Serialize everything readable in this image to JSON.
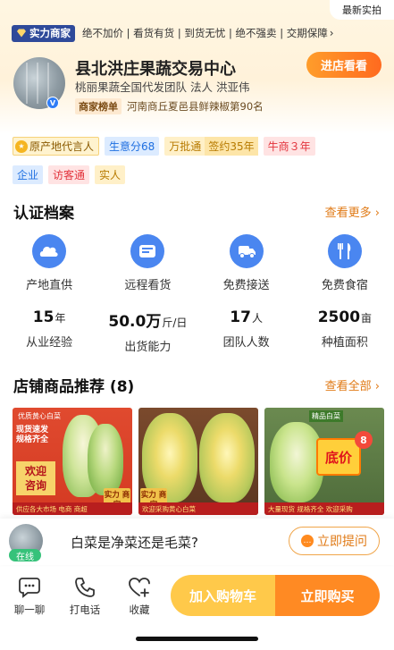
{
  "header": {
    "latest_photo": "最新实拍",
    "power_badge": "实力商家",
    "guarantees": "绝不加价 | 看货有货 | 到货无忧 | 绝不强卖 | 交期保障",
    "shop_name": "县北洪庄果蔬交易中心",
    "subtitle": "桃丽果蔬全国代发团队  法人  洪亚伟",
    "rank_tag": "商家榜单",
    "rank_text": "河南商丘夏邑县鲜辣椒第90名",
    "enter_button": "进店看看"
  },
  "tags": {
    "origin": "原产地代言人",
    "score": "生意分68",
    "wanpitong": "万批通",
    "sign": "签约35年",
    "niushang": "牛商３年",
    "qiye": "企业",
    "fangketong": "访客通",
    "shiren": "实人"
  },
  "certification": {
    "title": "认证档案",
    "more": "查看更多",
    "features": [
      {
        "label": "产地直供",
        "icon": "cloud-icon"
      },
      {
        "label": "远程看货",
        "icon": "camera-icon"
      },
      {
        "label": "免费接送",
        "icon": "car-icon"
      },
      {
        "label": "免费食宿",
        "icon": "utensils-icon"
      }
    ],
    "stats": [
      {
        "value": "15",
        "unit": "年",
        "label": "从业经验"
      },
      {
        "value": "50.0万",
        "unit": "斤/日",
        "label": "出货能力"
      },
      {
        "value": "17",
        "unit": "人",
        "label": "团队人数"
      },
      {
        "value": "2500",
        "unit": "亩",
        "label": "种植面积"
      }
    ]
  },
  "products": {
    "title": "店铺商品推荐 (8)",
    "more": "查看全部",
    "items": [
      {
        "top": "优质黄心白菜",
        "box": "现货速发 规格齐全",
        "welcome": "欢迎 咨询",
        "strip": "供应各大市场 电商 商超",
        "stamp": "实力 商家"
      },
      {
        "strip": "欢迎采购黄心白菜",
        "stamp": "实力 商家"
      },
      {
        "brand": "精品白菜",
        "price": "底价",
        "badge": "8",
        "strip": "大量现货 规格齐全 欢迎采购"
      }
    ]
  },
  "question": {
    "online": "在线",
    "text": "白菜是净菜还是毛菜?",
    "ask_button": "立即提问"
  },
  "bottom_bar": {
    "chat": "聊一聊",
    "call": "打电话",
    "favorite": "收藏",
    "add_cart": "加入购物车",
    "buy_now": "立即购买"
  },
  "colors": {
    "accent": "#ff8a23",
    "primary_blue": "#4a86f0",
    "more_link": "#e07a16"
  }
}
